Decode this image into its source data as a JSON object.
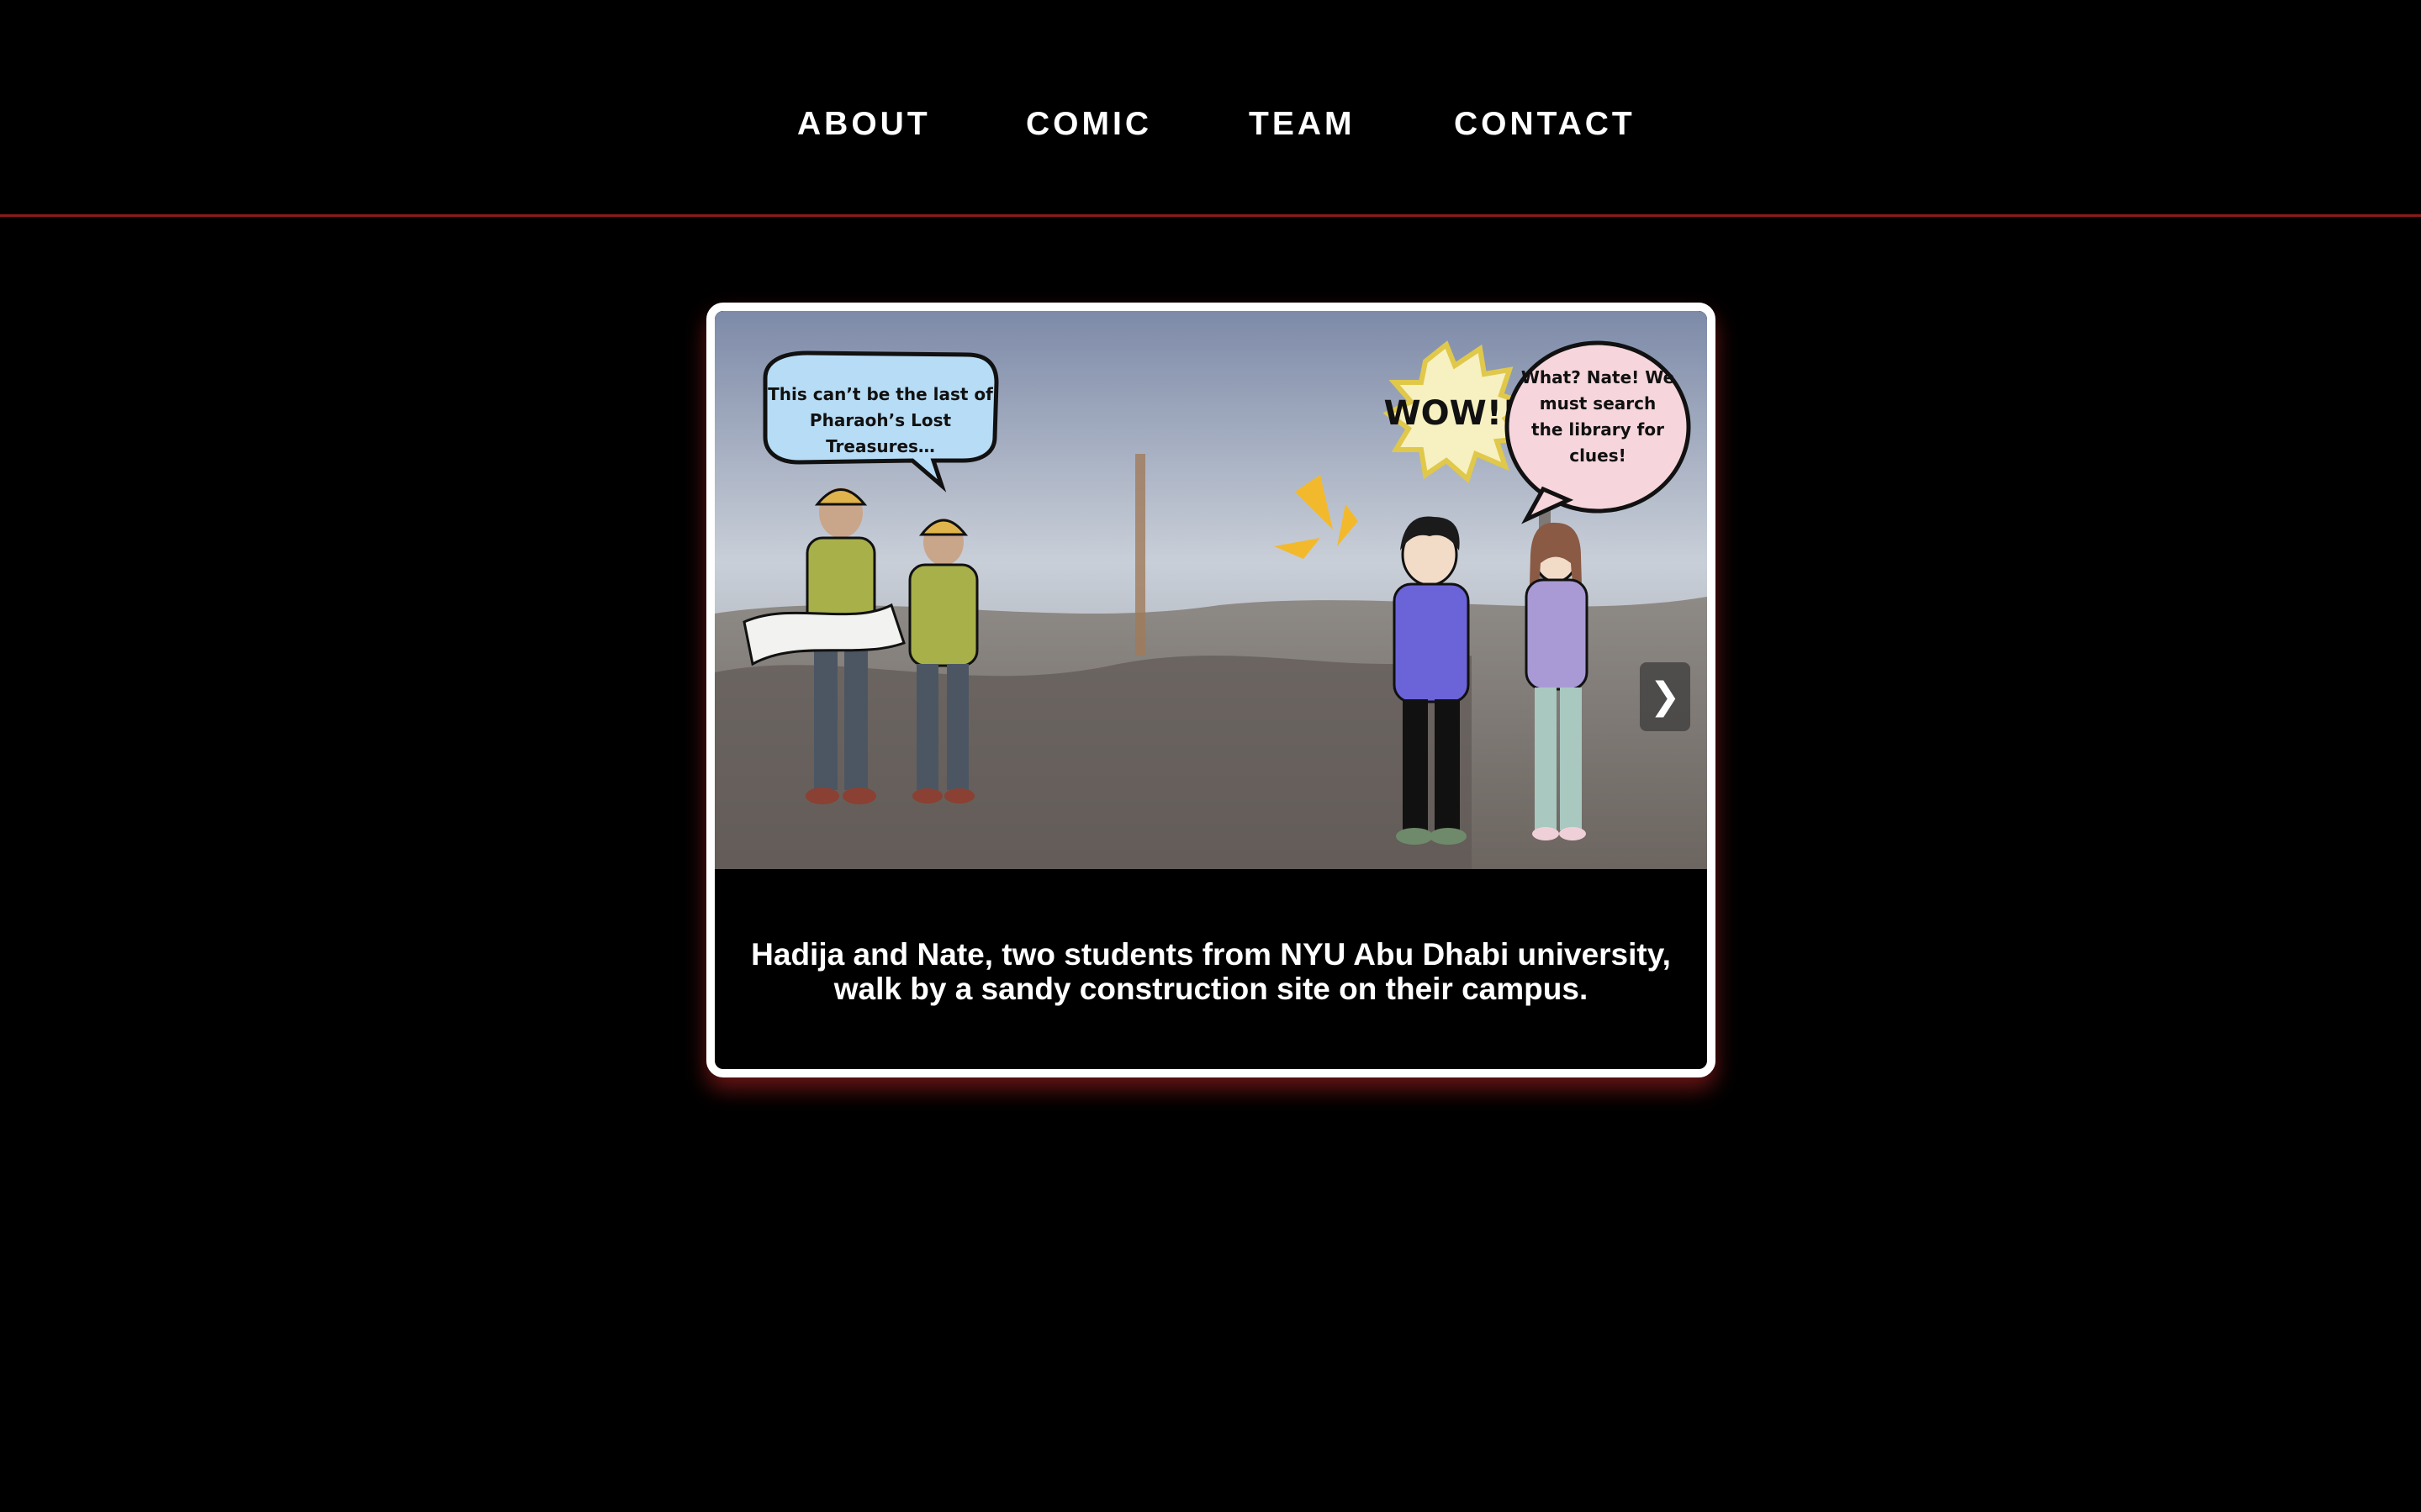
{
  "nav": {
    "items": [
      {
        "label": "ABOUT"
      },
      {
        "label": "COMIC"
      },
      {
        "label": "TEAM"
      },
      {
        "label": "CONTACT"
      }
    ]
  },
  "comic": {
    "bubble_left": {
      "line1": "This can’t be the last of",
      "line2": "Pharaoh’s Lost",
      "line3": "Treasures…"
    },
    "wow": "WOW!!!",
    "bubble_right": {
      "line1": "What? Nate! We",
      "line2": "must search",
      "line3": "the library for",
      "line4": "clues!"
    },
    "next_label": "❯",
    "caption": "Hadija and Nate, two students from NYU Abu Dhabi university, walk by a sandy construction site on their campus."
  },
  "colors": {
    "accent": "#8b1a1a",
    "bubble_left": "#b7dcf5",
    "bubble_right": "#f6d5dc",
    "wow_burst": "#f7f0c0"
  }
}
